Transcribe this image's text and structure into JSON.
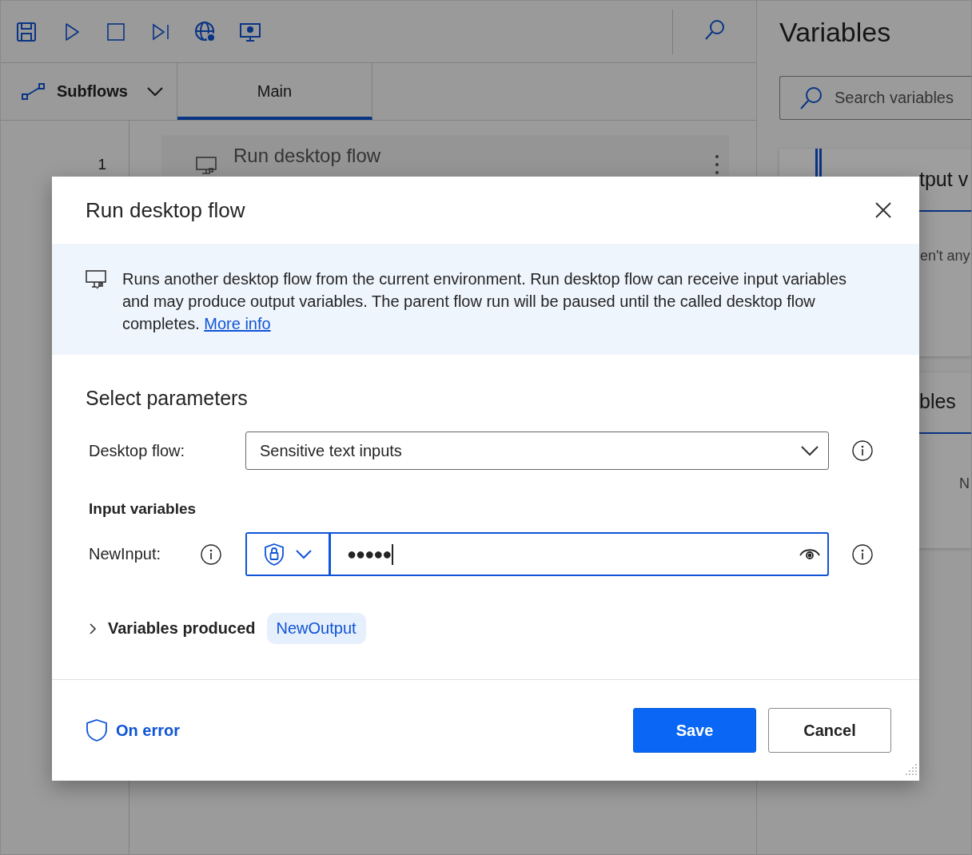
{
  "subflows": {
    "label": "Subflows",
    "expanded": false
  },
  "tabs": [
    {
      "label": "Main",
      "selected": true
    }
  ],
  "editor": {
    "line_numbers": [
      "1"
    ],
    "steps": [
      {
        "title": "Run desktop flow"
      }
    ]
  },
  "variables_panel": {
    "title": "Variables",
    "search": {
      "placeholder": "Search variables"
    },
    "sections": [
      {
        "heading": "tput v",
        "body": "en't any"
      },
      {
        "heading": "bles",
        "body": "N"
      }
    ]
  },
  "dialog": {
    "title": "Run desktop flow",
    "description": {
      "text": "Runs another desktop flow from the current environment. Run desktop flow can receive input variables and may produce output variables. The parent flow run will be paused until the called desktop flow completes.",
      "link": "More info"
    },
    "section_title": "Select parameters",
    "desktop_flow": {
      "label": "Desktop flow:",
      "value": "Sensitive text inputs"
    },
    "input_variables": {
      "heading": "Input variables",
      "items": [
        {
          "name": "NewInput:",
          "value": "●●●●●",
          "sensitive": true,
          "focused": true
        }
      ]
    },
    "variables_produced": {
      "label": "Variables produced",
      "expanded": false,
      "items": [
        "NewOutput"
      ]
    },
    "on_error": "On error",
    "buttons": [
      {
        "label": "Save",
        "kind": "primary"
      },
      {
        "label": "Cancel",
        "kind": "secondary"
      }
    ]
  }
}
